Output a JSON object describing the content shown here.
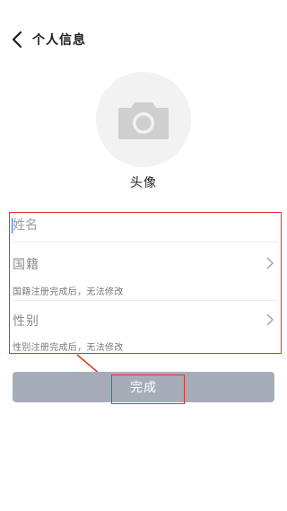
{
  "header": {
    "title": "个人信息",
    "back_icon": "chevron-left-icon"
  },
  "avatar": {
    "icon": "camera-icon",
    "label": "头像"
  },
  "form": {
    "name": {
      "placeholder": "姓名",
      "value": ""
    },
    "nationality": {
      "label": "国籍",
      "hint": "国籍注册完成后，无法修改",
      "icon": "chevron-right-icon"
    },
    "gender": {
      "label": "性别",
      "hint": "性别注册完成后，无法修改",
      "icon": "chevron-right-icon"
    }
  },
  "done_button": {
    "label": "完成"
  },
  "colors": {
    "annotation": "#e03030",
    "button_disabled": "#a7adb8",
    "avatar_bg": "#f2f2f2",
    "cursor": "#2a6cd6"
  }
}
